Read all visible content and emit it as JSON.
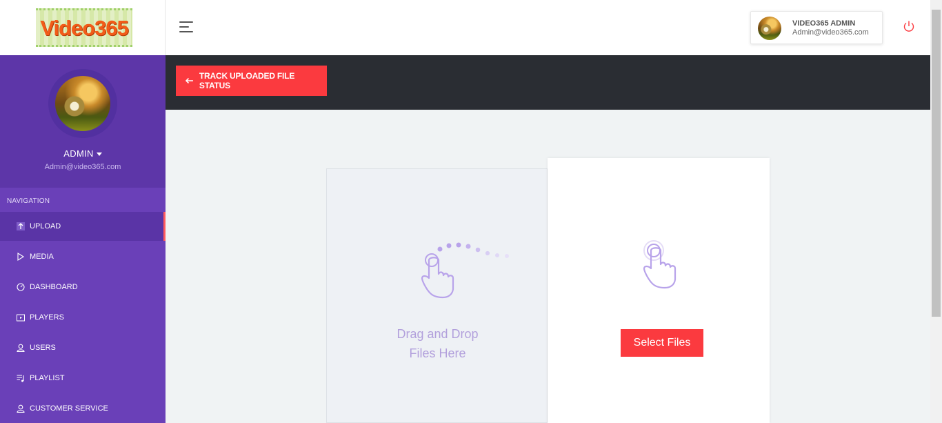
{
  "brand": {
    "logo_text": "Video365"
  },
  "profile": {
    "name": "ADMIN",
    "email": "Admin@video365.com"
  },
  "navigation": {
    "heading": "NAVIGATION",
    "items": [
      {
        "label": "UPLOAD",
        "icon": "upload-icon",
        "active": true
      },
      {
        "label": "MEDIA",
        "icon": "play-icon"
      },
      {
        "label": "DASHBOARD",
        "icon": "gauge-icon"
      },
      {
        "label": "PLAYERS",
        "icon": "tv-icon"
      },
      {
        "label": "USERS",
        "icon": "user-icon"
      },
      {
        "label": "PLAYLIST",
        "icon": "playlist-icon"
      },
      {
        "label": "CUSTOMER SERVICE",
        "icon": "user-icon"
      }
    ]
  },
  "header": {
    "user_name": "VIDEO365 ADMIN",
    "user_email": "Admin@video365.com"
  },
  "banner": {
    "track_button_label": "TRACK UPLOADED FILE STATUS"
  },
  "upload": {
    "drop_line1": "Drag and Drop",
    "drop_line2": "Files Here",
    "select_button_label": "Select Files"
  },
  "colors": {
    "sidebar": "#6a40b8",
    "accent": "#fb3a3f",
    "banner": "#2a2d33",
    "icon_purple": "#b2a0dc"
  }
}
